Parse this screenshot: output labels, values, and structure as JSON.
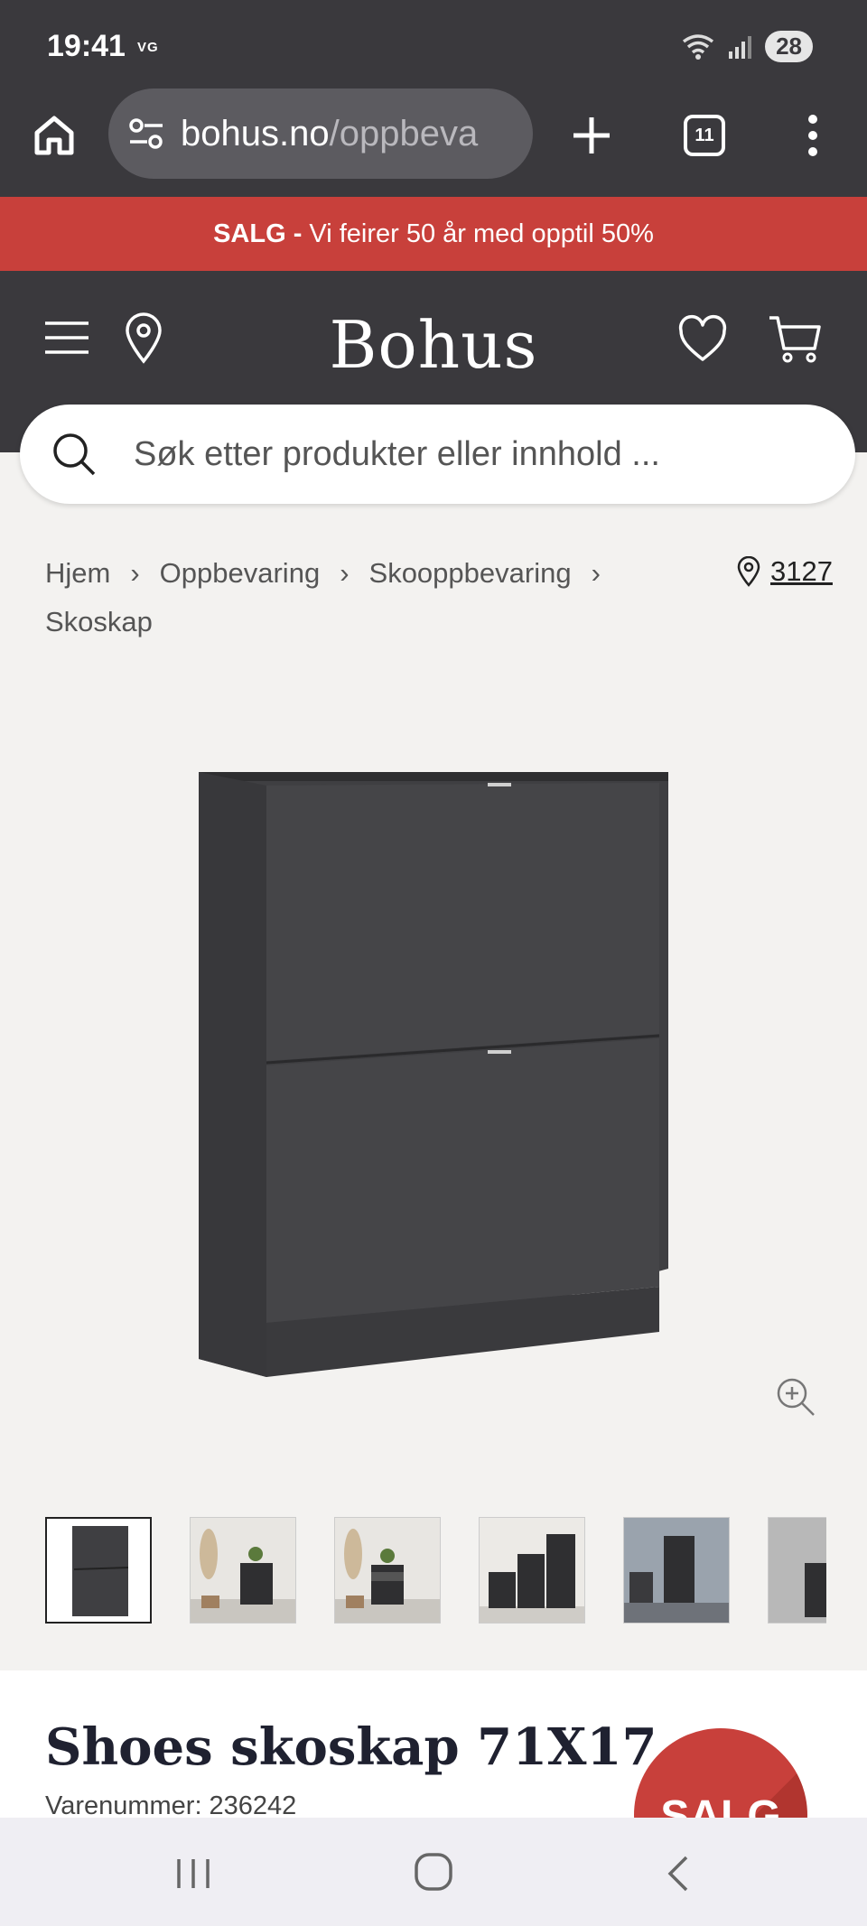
{
  "status_bar": {
    "time": "19:41",
    "carrier": "VG",
    "battery": "28"
  },
  "browser": {
    "url_host": "bohus.no",
    "url_path": "/oppbeva",
    "tab_count": "11"
  },
  "banner": {
    "bold": "SALG -",
    "text": "Vi feirer 50 år med opptil 50%",
    "color": "#c8403b"
  },
  "header": {
    "logo": "Bohus"
  },
  "search": {
    "placeholder": "Søk etter produkter eller innhold ..."
  },
  "breadcrumb": {
    "items": [
      "Hjem",
      "Oppbevaring",
      "Skooppbevaring",
      "Skoskap"
    ],
    "store_code": "3127"
  },
  "thumbnails": [
    {
      "name": "front-view",
      "active": true
    },
    {
      "name": "hallway-photo-1",
      "active": false
    },
    {
      "name": "hallway-photo-2-open",
      "active": false
    },
    {
      "name": "stacked-cabinets",
      "active": false
    },
    {
      "name": "room-photo",
      "active": false
    },
    {
      "name": "wall-photo",
      "active": false
    }
  ],
  "product": {
    "title": "Shoes skoskap 71X17",
    "sku_label": "Varenummer:",
    "sku": "236242",
    "badge": "SALG"
  },
  "icons": {
    "home": "home-icon",
    "tune": "site-settings-icon",
    "plus": "new-tab-icon",
    "menu": "more-menu-icon",
    "hamburger": "hamburger-menu-icon",
    "location": "location-pin-icon",
    "favorites": "heart-icon",
    "cart": "shopping-cart-icon",
    "search": "search-icon",
    "zoom": "zoom-in-icon"
  }
}
